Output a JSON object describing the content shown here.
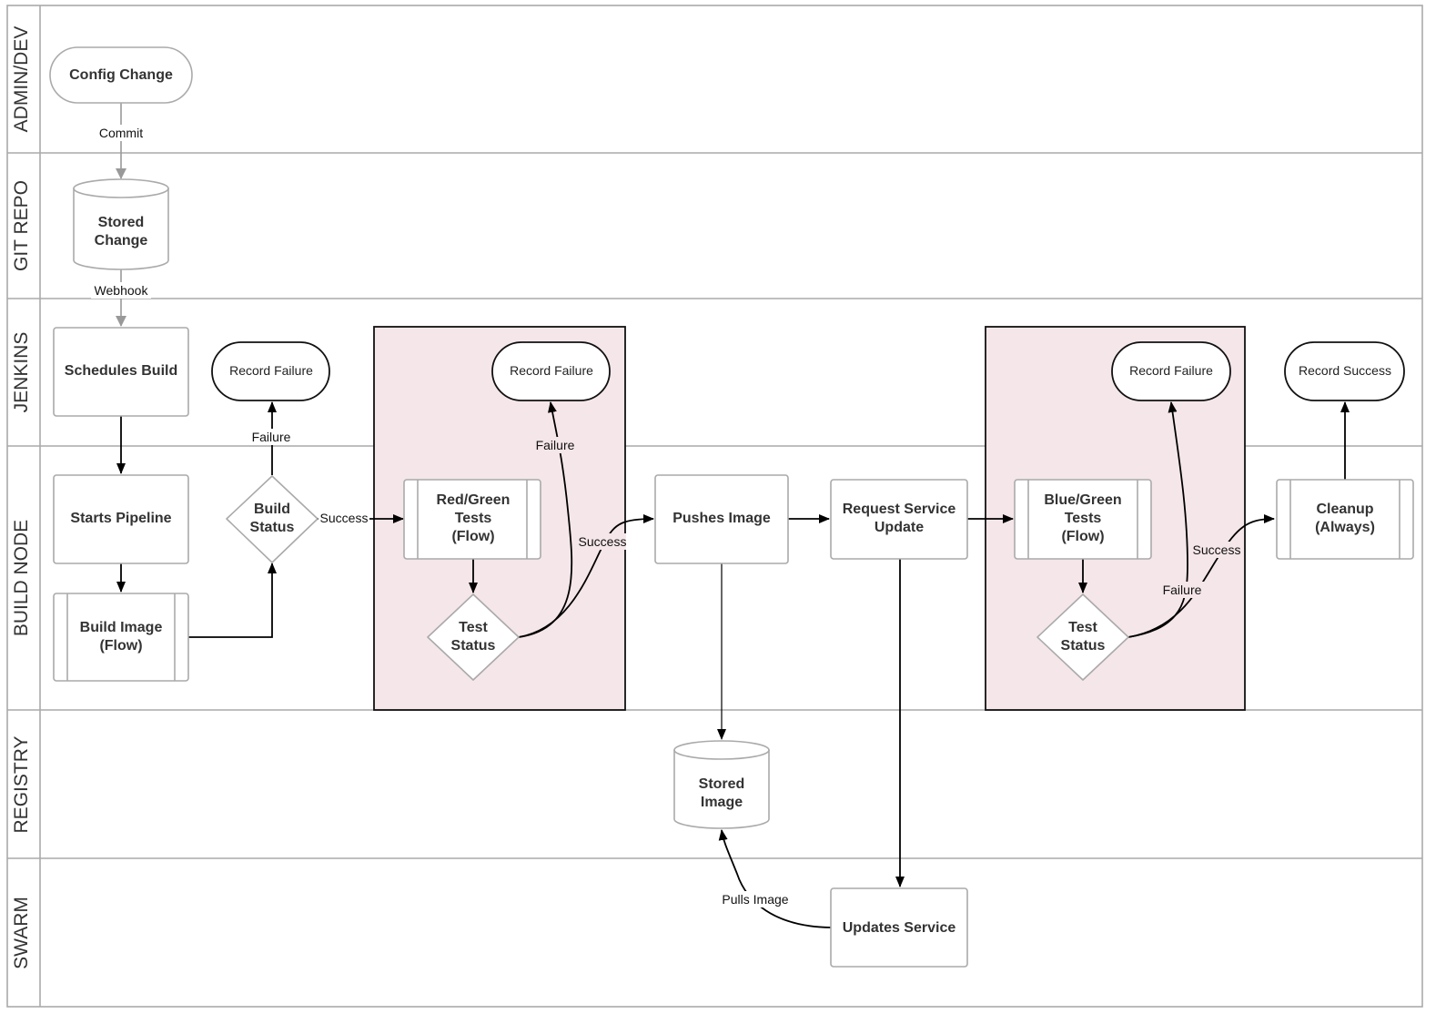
{
  "lanes": [
    "ADMIN/DEV",
    "GIT REPO",
    "JENKINS",
    "BUILD NODE",
    "REGISTRY",
    "SWARM"
  ],
  "colors": {
    "group_fill": "#f5e6e9",
    "lane_border": "#aaaaaa",
    "shape_border": "#aaaaaa"
  },
  "nodes": {
    "config_change": "Config Change",
    "stored_change": [
      "Stored",
      "Change"
    ],
    "schedules_build": "Schedules Build",
    "record_failure_1": "Record Failure",
    "record_failure_2": "Record Failure",
    "record_failure_3": "Record Failure",
    "record_success": "Record Success",
    "starts_pipeline": "Starts Pipeline",
    "build_image": [
      "Build Image",
      "(Flow)"
    ],
    "build_status": [
      "Build",
      "Status"
    ],
    "red_green_tests": [
      "Red/Green",
      "Tests",
      "(Flow)"
    ],
    "test_status_1": [
      "Test",
      "Status"
    ],
    "pushes_image": "Pushes Image",
    "request_service_update": [
      "Request Service",
      "Update"
    ],
    "blue_green_tests": [
      "Blue/Green",
      "Tests",
      "(Flow)"
    ],
    "test_status_2": [
      "Test",
      "Status"
    ],
    "cleanup": [
      "Cleanup",
      "(Always)"
    ],
    "stored_image": [
      "Stored",
      "Image"
    ],
    "updates_service": "Updates Service"
  },
  "edge_labels": {
    "commit": "Commit",
    "webhook": "Webhook",
    "build_failure": "Failure",
    "build_success": "Success",
    "test1_failure": "Failure",
    "test1_success": "Success",
    "test2_failure": "Failure",
    "test2_success": "Success",
    "pulls_image": "Pulls Image"
  }
}
